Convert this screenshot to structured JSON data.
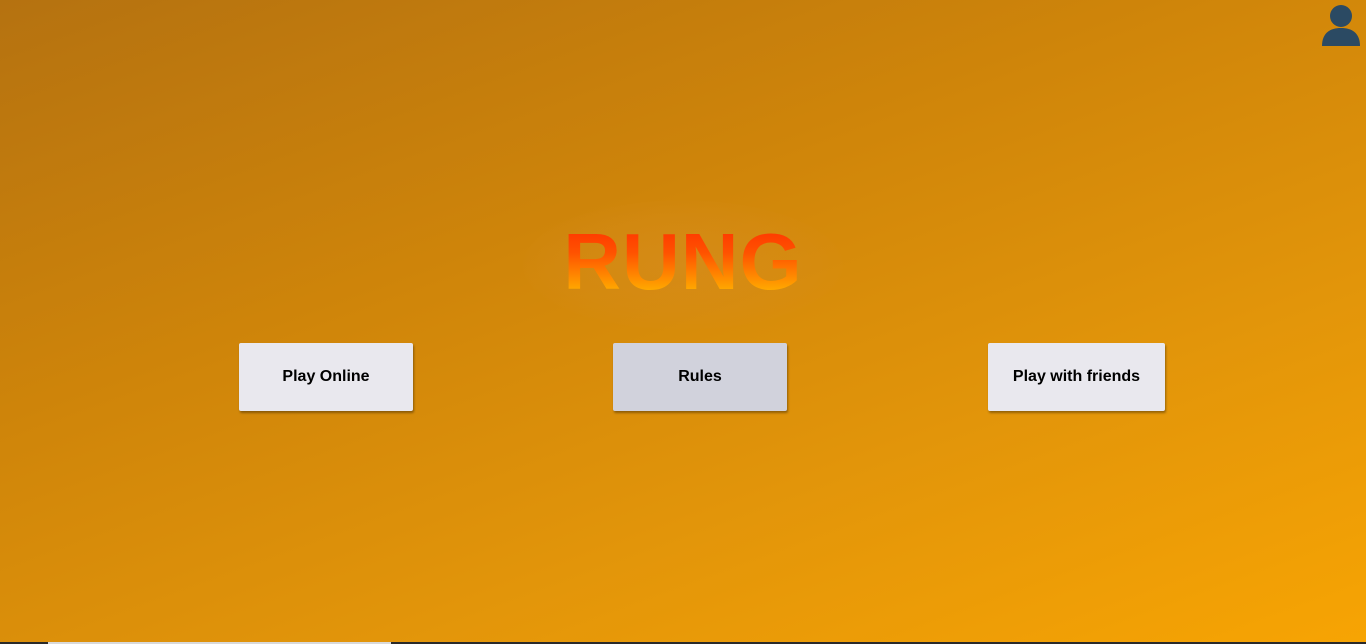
{
  "app": {
    "title": "RUNG"
  },
  "menu": {
    "play_online": "Play Online",
    "rules": "Rules",
    "play_with_friends": "Play with friends"
  },
  "header": {
    "profile_icon": "user-icon"
  },
  "colors": {
    "background_start": "#b57210",
    "background_end": "#f7a403",
    "title_top": "#ff2a00",
    "title_bottom": "#ffd000",
    "button_bg": "#e9e8ee",
    "button_active_bg": "#d1d2dc",
    "user_icon": "#2b4a63"
  }
}
